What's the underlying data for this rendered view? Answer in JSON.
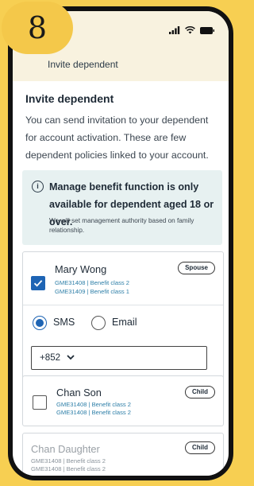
{
  "step_number": "8",
  "header": {
    "title": "Invite dependent"
  },
  "page": {
    "title": "Invite dependent",
    "description": "You can send invitation to your dependent for account activation. These are few dependent policies linked to your account."
  },
  "info": {
    "icon": "info-circle-icon",
    "heading": "Manage benefit function is only available for dependent aged 18 or over.",
    "note": "We will set management authority based on family relationship."
  },
  "dependents": [
    {
      "name": "Mary Wong",
      "lines": [
        "GME31408 | Benefit class 2",
        "GME31409 | Benefit class 1"
      ],
      "relationship": "Spouse",
      "checked": true
    },
    {
      "name": "Chan Son",
      "lines": [
        "GME31408 | Benefit class 2",
        "GME31408 | Benefit class 2"
      ],
      "relationship": "Child",
      "checked": false
    },
    {
      "name": "Chan Daughter",
      "lines": [
        "GME31408 | Benefit class 2",
        "GME31408 | Benefit class 2"
      ],
      "relationship": "Child",
      "checked": false
    }
  ],
  "contact_method": {
    "options": [
      "SMS",
      "Email"
    ],
    "selected": "SMS"
  },
  "country_code": "+852",
  "colors": {
    "accent": "#1e64b4",
    "badge": "#f4c84a",
    "background": "#f7cf52"
  }
}
